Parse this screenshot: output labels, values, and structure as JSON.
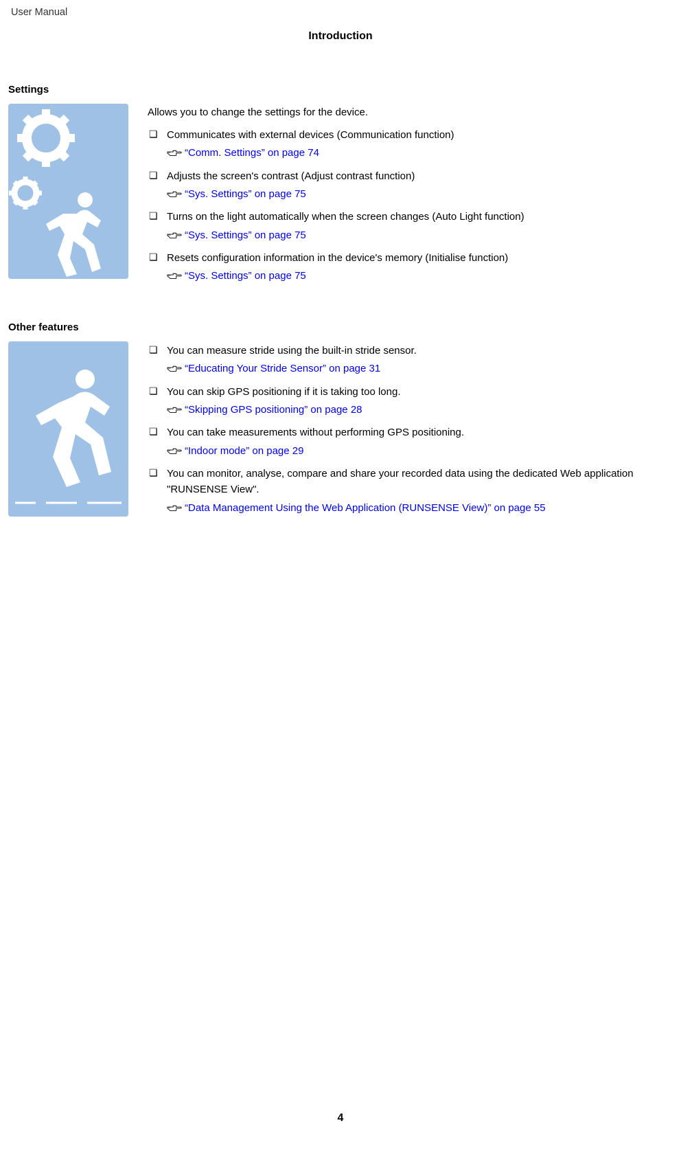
{
  "header": {
    "doc_title": "User Manual",
    "chapter": "Introduction"
  },
  "sections": {
    "settings": {
      "heading": "Settings",
      "intro": "Allows you to change the settings for the device.",
      "items": [
        {
          "text": "Communicates with external devices (Communication function)",
          "ref": "“Comm. Settings” on page 74"
        },
        {
          "text": "Adjusts the screen's contrast (Adjust contrast function)",
          "ref": "“Sys. Settings” on page 75"
        },
        {
          "text": "Turns on the light automatically when the screen changes (Auto Light function)",
          "ref": "“Sys. Settings” on page 75"
        },
        {
          "text": "Resets configuration information in the device's memory (Initialise function)",
          "ref": "“Sys. Settings” on page 75"
        }
      ]
    },
    "other": {
      "heading": "Other features",
      "items": [
        {
          "text": "You can measure stride using the built-in stride sensor.",
          "ref": "“Educating Your Stride Sensor” on page 31"
        },
        {
          "text": "You can skip GPS positioning if it is taking too long.",
          "ref": "“Skipping GPS positioning” on page 28"
        },
        {
          "text": "You can take measurements without performing GPS positioning.",
          "ref": "“Indoor mode” on page 29"
        },
        {
          "text": "You can monitor, analyse, compare and share your recorded data using the dedicated Web application \"RUNSENSE View\".",
          "ref": "“Data Management Using the Web Application (RUNSENSE View)” on page 55"
        }
      ]
    }
  },
  "page_number": "4"
}
